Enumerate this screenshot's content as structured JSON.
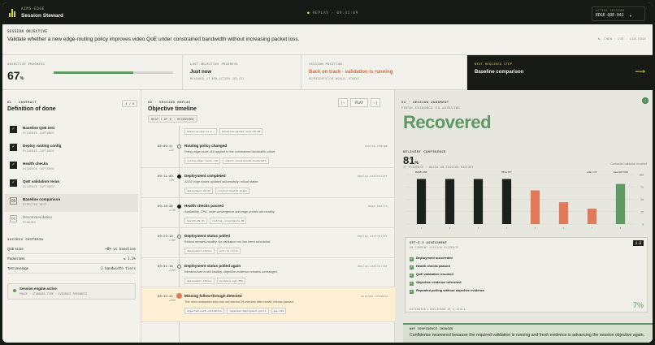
{
  "app": {
    "brand_top": "AIMS-EDGE",
    "brand_name": "Session Steward",
    "replay_label": "REPLAY",
    "replay_time": "09:41:09",
    "session_label": "ACTIVE SESSION",
    "session_value": "EDGE-QOE-042"
  },
  "objective": {
    "label": "SESSION OBJECTIVE",
    "text": "Validate whether a new edge-routing policy improves video QoE under constrained bandwidth without increasing packet loss.",
    "meta": "N. CHEN · VIE · LIB-EDGE"
  },
  "metrics": {
    "progress_label": "OBJECTIVE PROGRESS",
    "progress_value": "67",
    "progress_unit": "%",
    "progress_fraction": 0.67,
    "last_label": "LAST OBJECTIVE PROGRESS",
    "last_value": "Just now",
    "last_sub": "MEASURED AT NEW ACTION (09:41)",
    "position_label": "SESSION POSITION",
    "position_value": "Back on track · validation is running",
    "position_sub": "REPRESENTATIVE WORLD, STABLE",
    "next_label": "NEXT REQUIRED STEP",
    "next_value": "Baseline comparison"
  },
  "contract": {
    "section": "01 · CONTRACT",
    "title": "Definition of done",
    "pill": "4 / 6",
    "steps": [
      {
        "name": "Baseline QoE test",
        "state": "EVIDENCE CAPTURED",
        "mark": "✓",
        "kind": "done"
      },
      {
        "name": "Deploy routing config",
        "state": "EVIDENCE CAPTURED",
        "mark": "✓",
        "kind": "done"
      },
      {
        "name": "Health checks",
        "state": "EVIDENCE CAPTURED",
        "mark": "✓",
        "kind": "done"
      },
      {
        "name": "QoE validation rerun",
        "state": "EVIDENCE CAPTURED",
        "mark": "✓",
        "kind": "done"
      },
      {
        "name": "Baseline comparison",
        "state": "EXPECTED NEXT",
        "mark": "05",
        "kind": "current"
      },
      {
        "name": "Recommendation",
        "state": "PENDING",
        "mark": "06",
        "kind": "pending"
      }
    ],
    "criteria_label": "SUCCESS CRITERIA",
    "criteria": [
      {
        "k": "QoE score",
        "v": "+8% vs baseline"
      },
      {
        "k": "Packet loss",
        "v": "≤ 1.2%"
      },
      {
        "k": "Test coverage",
        "v": "2 bandwidth tiers"
      }
    ],
    "engine_title": "Session engine active",
    "engine_sub": "PHASE · STANDARD TIME · EVIDENCE FRESHNESS"
  },
  "replay": {
    "section": "02 · SESSION REPLAY",
    "title": "Objective timeline",
    "play": "PLAY",
    "prev": "|‹",
    "next": "›|",
    "pill": "BEAT 1 OF 6 · RECOVERED",
    "top_tags": [
      "baseline-qoe-v1.2 ✓",
      "baseline-packet-loss-00.08"
    ],
    "events": [
      {
        "time": "09:09:41",
        "dur": "+4S",
        "title": "Routing policy changed",
        "src": "config-change",
        "desc": "Policy edge-route-v18 applied to the constrained bandwidth cohort.",
        "tags": [
          "config-edge-route-v18",
          "cohort-constrained-bandwidth"
        ],
        "dot": "open"
      },
      {
        "time": "09:11:09",
        "dur": "+9M",
        "title": "Deployment completed",
        "src": "deploy-controller",
        "desc": "22/22 edge nodes updated successfully; rollout stable.",
        "tags": [
          "deployment-22/22",
          "rollout-health-green"
        ],
        "dot": "filled"
      },
      {
        "time": "09:18:38",
        "dur": "+13M",
        "title": "Health checks passed",
        "src": "edge-health",
        "desc": "Availability, CPU, route convergence and edge probes are healthy.",
        "tags": [
          "health-99.9%",
          "routing-convergence-OK"
        ],
        "dot": "filled"
      },
      {
        "time": "09:23:10",
        "dur": "+18M",
        "title": "Deployment status polled",
        "src": "deploy-controller",
        "desc": "Rollout remains healthy. No validation run has been scheduled.",
        "tags": [
          "deployment-status",
          "poll-no-rerun"
        ],
        "dot": "open"
      },
      {
        "time": "09:31:18",
        "dur": "+26M",
        "title": "Deployment status polled again",
        "src": "deploy-controller",
        "desc": "Infrastructure is still healthy; objective evidence remains unchanged.",
        "tags": [
          "deployment-status",
          "evidence-age-35m"
        ],
        "dot": "open"
      },
      {
        "time": "09:35:44",
        "dur": "+31M",
        "title": "Missing follow-through detected",
        "src": "session-steward",
        "desc": "The next contracted step has not started 24 minutes after health checks passed.",
        "tags": [
          "expected-next-validation",
          "repeated-deployment-polls",
          "gap-24m"
        ],
        "dot": "red"
      }
    ]
  },
  "judgment": {
    "section": "03 · SESSION JUDGMENT",
    "sub": "FRESH EVIDENCE IS ARRIVING",
    "verdict": "Recovered",
    "conf_label": "DELIVERY CONFIDENCE",
    "conf_value": "81",
    "conf_unit": "%",
    "conf_sub": "IF EVIDENCE · BASED ON SESSION HISTORY",
    "conf_note": "Contracted validation resumed",
    "assess_label": "GPT-5.5 ASSESSMENT",
    "assess_sub": "ON CURRENT SESSION EVIDENCE",
    "assess_badge": "4.8",
    "checks": [
      "Deployment succeeded",
      "Health checks passed",
      "QoE validation resumed",
      "Objective evidence refreshed",
      "Repeated polling without objective evidence"
    ],
    "foot": "ESTIMATED LIKELIHOOD OF A STALL",
    "stall_pct": "7%",
    "why_label": "WHY CONFIDENCE CHANGED",
    "why_text": "Confidence recovered because the required validation is running and fresh evidence is advancing the session objective again."
  },
  "chart_data": {
    "type": "bar",
    "categories": [
      "1",
      "2",
      "3",
      "4",
      "5",
      "6",
      "7",
      "8"
    ],
    "values": [
      91,
      91,
      91,
      91,
      68,
      44,
      31,
      81
    ],
    "bar_colors": [
      "#1d211b",
      "#1d211b",
      "#1d211b",
      "#1d211b",
      "#e07a5a",
      "#e07a5a",
      "#e07a5a",
      "#5e9a62"
    ],
    "annotations": [
      {
        "index": 0,
        "label": "BASELINE"
      },
      {
        "index": 3,
        "label": "HEALTHY"
      },
      {
        "index": 6,
        "label": "LOW CUT"
      },
      {
        "index": 7,
        "label": "VALIDATION"
      }
    ],
    "ylim": [
      0,
      100
    ],
    "yticks": [
      "100",
      "75",
      "50",
      "25",
      "0"
    ],
    "grid": true
  }
}
